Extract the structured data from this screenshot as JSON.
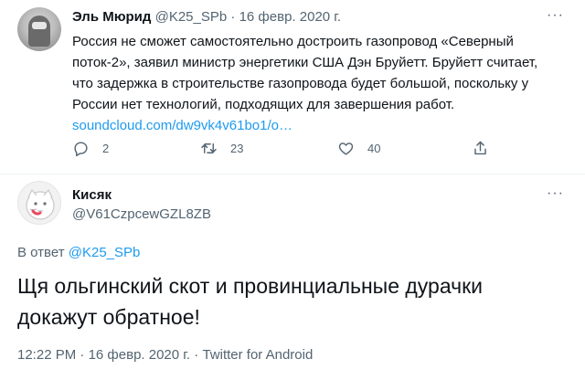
{
  "tweet1": {
    "author_name": "Эль Мюрид",
    "handle": "@K25_SPb",
    "separator": "·",
    "date": "16 февр. 2020 г.",
    "text": "Россия не сможет самостоятельно достроить газопровод «Северный поток-2», заявил министр энергетики США Дэн Бруйетт. Бруйетт считает, что задержка в строительстве газопровода будет большой, поскольку у России нет технологий, подходящих для завершения работ.",
    "link": "soundcloud.com/dw9vk4v61bo1/o…",
    "more": "···",
    "actions": {
      "reply_icon": "reply-icon",
      "reply_count": "2",
      "retweet_icon": "retweet-icon",
      "retweet_count": "23",
      "like_icon": "heart-icon",
      "like_count": "40",
      "share_icon": "share-icon"
    }
  },
  "tweet2": {
    "author_name": "Кисяк",
    "handle": "@V61CzpcewGZL8ZB",
    "more": "···",
    "reply_prefix": "В ответ",
    "reply_to": "@K25_SPb",
    "text": "Щя ольгинский скот и провинциальные дурачки докажут обратное!",
    "time": "12:22 PM",
    "date": "16 февр. 2020 г.",
    "separator": "·",
    "source": "Twitter for Android"
  },
  "colors": {
    "link": "#1d9bf0",
    "secondary": "#536471",
    "primary": "#0f1419",
    "divider": "#eff3f4"
  }
}
